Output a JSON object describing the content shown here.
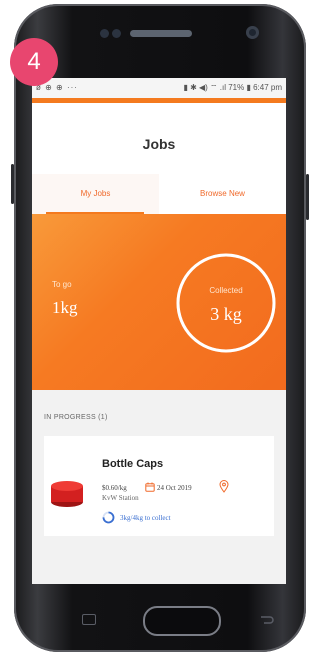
{
  "status_bar": {
    "left_icons": "ø ⊕ ⊕ ···",
    "right": "▮ ✱ ◀) ⌔ .ıl 71% ▮ 6:47 pm"
  },
  "badge": {
    "number": "4"
  },
  "header": {
    "title": "Jobs"
  },
  "tabs": [
    {
      "label": "My Jobs",
      "active": true
    },
    {
      "label": "Browse New",
      "active": false
    }
  ],
  "summary": {
    "togo_label": "To go",
    "togo_value": "1kg",
    "collected_label": "Collected",
    "collected_value": "3 kg"
  },
  "in_progress": {
    "section_title": "IN PROGRESS (1)",
    "jobs": [
      {
        "name": "Bottle Caps",
        "rate": "$0.60/kg",
        "date": "24 Oct 2019",
        "station": "KvW Station",
        "progress_text": "3kg/4kg to collect",
        "progress_fraction": 0.75,
        "icons": [
          "bottle-cap-image",
          "calendar-icon",
          "location-pin-icon",
          "progress-ring-icon"
        ]
      }
    ]
  },
  "colors": {
    "accent": "#f47a1f",
    "badge": "#e8466f",
    "progress": "#3a6fd1"
  }
}
